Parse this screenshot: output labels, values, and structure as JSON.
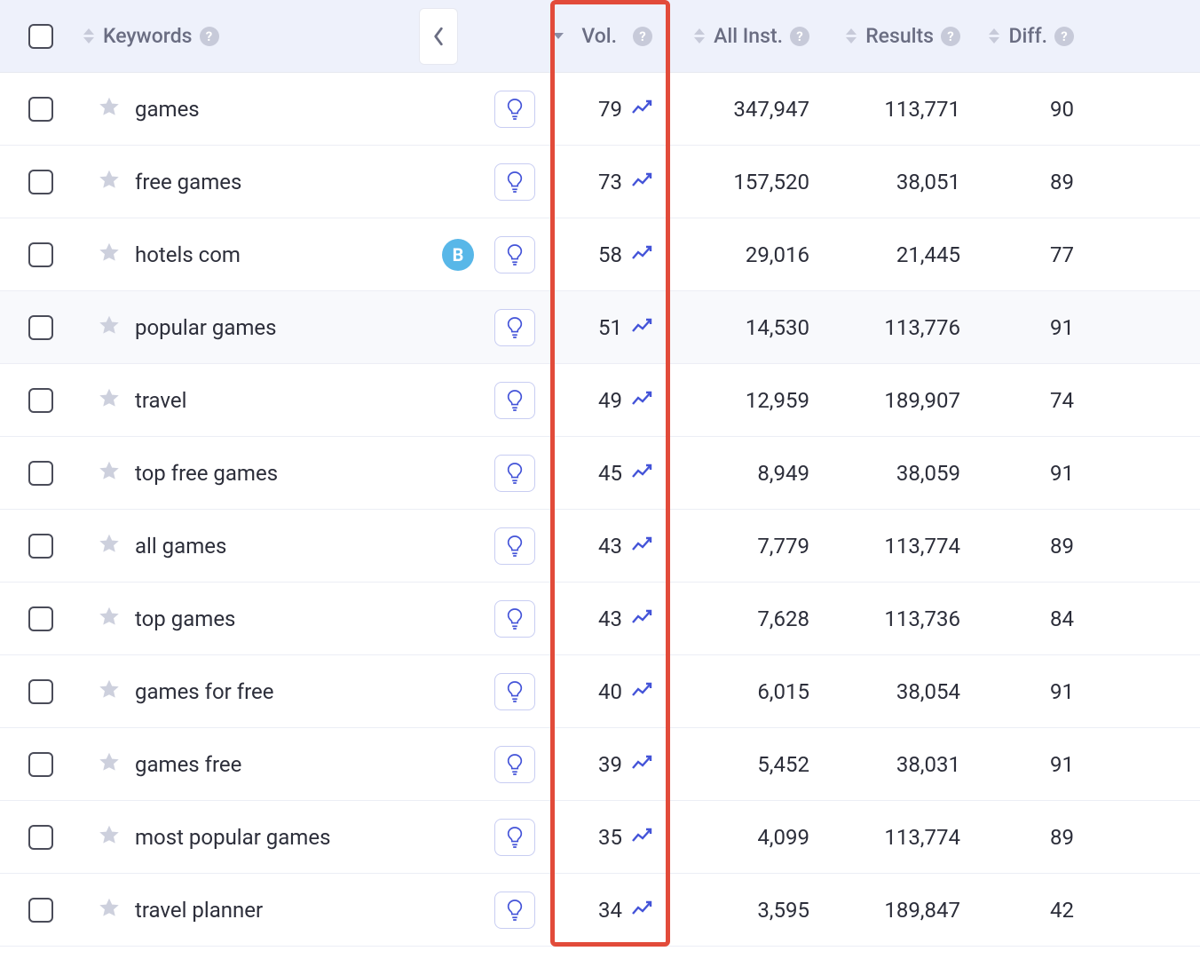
{
  "columns": {
    "keywords": "Keywords",
    "vol": "Vol.",
    "allinst": "All Inst.",
    "results": "Results",
    "diff": "Diff."
  },
  "badge_b": "B",
  "rows": [
    {
      "keyword": "games",
      "vol": "79",
      "allinst": "347,947",
      "results": "113,771",
      "diff": "90",
      "badge": false
    },
    {
      "keyword": "free games",
      "vol": "73",
      "allinst": "157,520",
      "results": "38,051",
      "diff": "89",
      "badge": false
    },
    {
      "keyword": "hotels com",
      "vol": "58",
      "allinst": "29,016",
      "results": "21,445",
      "diff": "77",
      "badge": true
    },
    {
      "keyword": "popular games",
      "vol": "51",
      "allinst": "14,530",
      "results": "113,776",
      "diff": "91",
      "badge": false,
      "shade": true
    },
    {
      "keyword": "travel",
      "vol": "49",
      "allinst": "12,959",
      "results": "189,907",
      "diff": "74",
      "badge": false
    },
    {
      "keyword": "top free games",
      "vol": "45",
      "allinst": "8,949",
      "results": "38,059",
      "diff": "91",
      "badge": false
    },
    {
      "keyword": "all games",
      "vol": "43",
      "allinst": "7,779",
      "results": "113,774",
      "diff": "89",
      "badge": false
    },
    {
      "keyword": "top games",
      "vol": "43",
      "allinst": "7,628",
      "results": "113,736",
      "diff": "84",
      "badge": false
    },
    {
      "keyword": "games for free",
      "vol": "40",
      "allinst": "6,015",
      "results": "38,054",
      "diff": "91",
      "badge": false
    },
    {
      "keyword": "games free",
      "vol": "39",
      "allinst": "5,452",
      "results": "38,031",
      "diff": "91",
      "badge": false
    },
    {
      "keyword": "most popular games",
      "vol": "35",
      "allinst": "4,099",
      "results": "113,774",
      "diff": "89",
      "badge": false
    },
    {
      "keyword": "travel planner",
      "vol": "34",
      "allinst": "3,595",
      "results": "189,847",
      "diff": "42",
      "badge": false
    }
  ]
}
